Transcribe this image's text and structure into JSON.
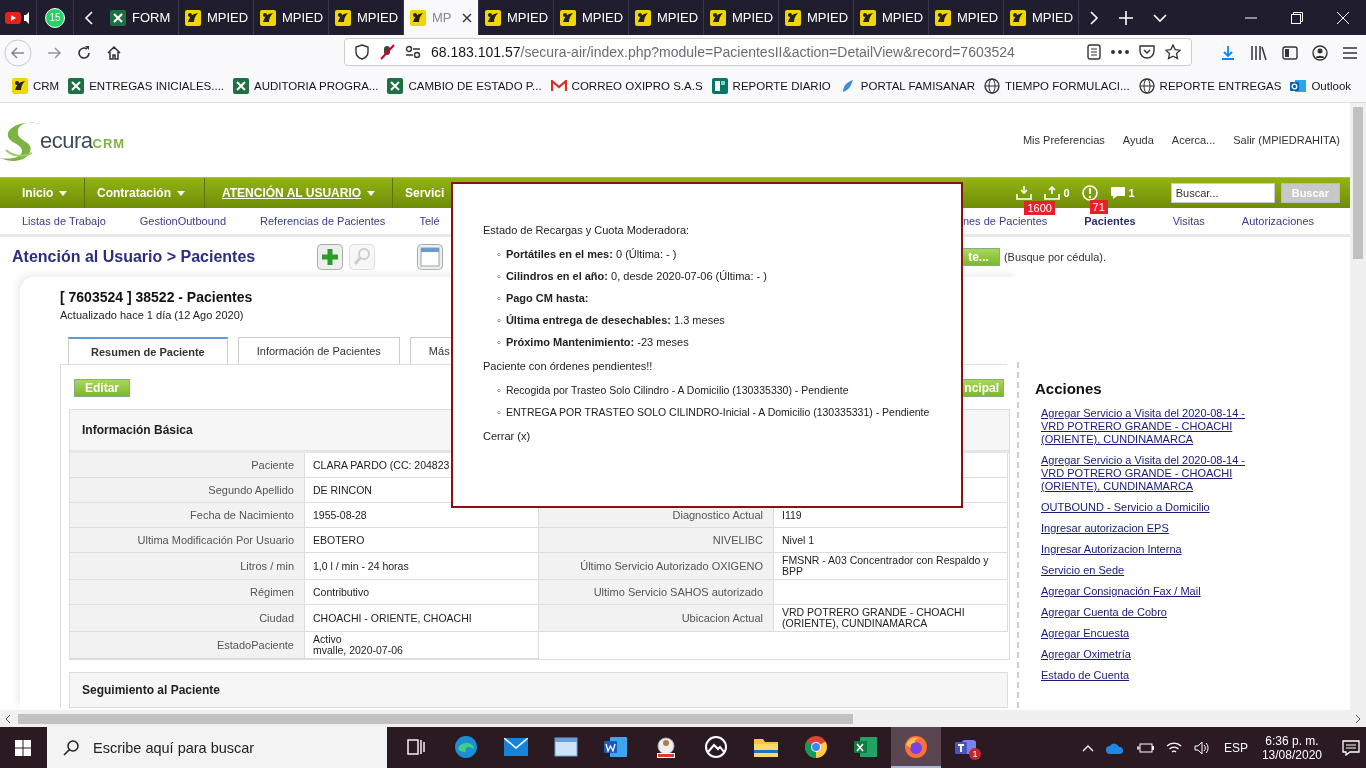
{
  "browser": {
    "pinned_tabs": [
      {
        "kind": "video"
      },
      {
        "kind": "chat",
        "badge": "15"
      }
    ],
    "tabs": [
      {
        "label": "FORM",
        "kind": "sheet",
        "selected": false
      },
      {
        "label": "MPIED",
        "kind": "crm",
        "selected": false
      },
      {
        "label": "MPIED",
        "kind": "crm",
        "selected": false
      },
      {
        "label": "MPIED",
        "kind": "crm",
        "selected": false
      },
      {
        "label": "MP",
        "kind": "crm",
        "selected": true
      },
      {
        "label": "MPIED",
        "kind": "crm",
        "selected": false
      },
      {
        "label": "MPIED",
        "kind": "crm",
        "selected": false
      },
      {
        "label": "MPIED",
        "kind": "crm",
        "selected": false
      },
      {
        "label": "MPIED",
        "kind": "crm",
        "selected": false
      },
      {
        "label": "MPIED",
        "kind": "crm",
        "selected": false
      },
      {
        "label": "MPIED",
        "kind": "crm",
        "selected": false
      },
      {
        "label": "MPIED",
        "kind": "crm",
        "selected": false
      },
      {
        "label": "MPIED",
        "kind": "crm",
        "selected": false
      }
    ],
    "url": {
      "host": "68.183.101.57",
      "path": "/secura-air/index.php?module=PacientesII&action=DetailView&record=7603524"
    },
    "bookmarks": [
      {
        "label": "CRM",
        "kind": "crm"
      },
      {
        "label": "ENTREGAS INICIALES....",
        "kind": "sheet"
      },
      {
        "label": "AUDITORIA PROGRA...",
        "kind": "sheet"
      },
      {
        "label": "CAMBIO DE ESTADO P...",
        "kind": "sheet"
      },
      {
        "label": "CORREO OXIPRO S.A.S",
        "kind": "mail"
      },
      {
        "label": "REPORTE DIARIO",
        "kind": "form"
      },
      {
        "label": "PORTAL FAMISANAR",
        "kind": "leaf"
      },
      {
        "label": "TIEMPO FORMULACI...",
        "kind": "globe"
      },
      {
        "label": "REPORTE ENTREGAS",
        "kind": "globe"
      },
      {
        "label": "Outlook",
        "kind": "outlook"
      }
    ]
  },
  "header": {
    "logo": {
      "word": "ecura",
      "suffix": "CRM"
    },
    "links": [
      "Mis Preferencias",
      "Ayuda",
      "Acerca...",
      "Salir (MPIEDRAHITA)"
    ]
  },
  "main_nav": {
    "items": [
      {
        "label": "Inicio",
        "selected": false,
        "has_menu": true
      },
      {
        "label": "Contratación",
        "selected": false,
        "has_menu": true
      },
      {
        "label": "ATENCIÓN AL USUARIO",
        "selected": true,
        "has_menu": true
      },
      {
        "label": "Servici",
        "selected": false,
        "has_menu": false
      }
    ],
    "notifications": [
      {
        "kind": "inbox",
        "badge": "1600"
      },
      {
        "kind": "outbox",
        "count": "0"
      },
      {
        "kind": "alert",
        "badge": "71"
      },
      {
        "kind": "chat",
        "count": "1"
      }
    ],
    "search": {
      "placeholder": "Buscar...",
      "button": "Buscar"
    }
  },
  "sub_nav": {
    "left": [
      {
        "label": "Listas de Trabajo",
        "selected": false
      },
      {
        "label": "GestionOutbound",
        "selected": false
      },
      {
        "label": "Referencias de Pacientes",
        "selected": false
      },
      {
        "label": "Telé",
        "selected": false
      }
    ],
    "right": [
      {
        "label": "nes de Pacientes",
        "selected": false
      },
      {
        "label": "Pacientes",
        "selected": true
      },
      {
        "label": "Visitas",
        "selected": false
      },
      {
        "label": "Autorizaciones",
        "selected": false
      }
    ]
  },
  "page": {
    "breadcrumb": "Atención al Usuario > Pacientes",
    "search_button": "te...",
    "search_hint": "(Busque por cédula).",
    "record_title": "[ 7603524 ] 38522 - Pacientes",
    "updated": "Actualizado hace 1 día (12 Ago 2020)",
    "tabs": [
      {
        "label": "Resumen de Paciente",
        "selected": true
      },
      {
        "label": "Información de Pacientes",
        "selected": false
      },
      {
        "label": "Más",
        "selected": false
      }
    ],
    "edit_button": "Editar",
    "right_button": "ncipal",
    "section": "Información Básica",
    "rows": [
      {
        "label": "Paciente",
        "value": "CLARA PARDO (CC: 204823"
      },
      {
        "label": "Segundo Apellido",
        "value": "DE RINCON"
      },
      {
        "label": "Fecha de Nacimiento",
        "value": "1955-08-28"
      },
      {
        "label": "Ultima Modificación Por Usuario",
        "value": "EBOTERO"
      },
      {
        "label": "Litros / min",
        "value": "1,0 l / min - 24 horas"
      },
      {
        "label": "Régimen",
        "value": "Contributivo"
      },
      {
        "label": "Ciudad",
        "value": "CHOACHI - ORIENTE, CHOACHI"
      },
      {
        "label": "EstadoPaciente",
        "value": "Activo",
        "note": "mvalle, 2020-07-06"
      }
    ],
    "right_rows": [
      {
        "label": "Diagnostico Actual",
        "value": "I119"
      },
      {
        "label": "NIVELIBC",
        "value": "Nivel 1"
      },
      {
        "label": "Último Servicio Autorizado OXIGENO",
        "value": "FMSNR - A03 Concentrador con Respaldo y BPP"
      },
      {
        "label": "Ultimo Servicio SAHOS autorizado"
      },
      {
        "label": "Ubicacion Actual",
        "value": "VRD POTRERO GRANDE - CHOACHI (ORIENTE), CUNDINAMARCA"
      }
    ],
    "next_section": "Seguimiento al Paciente"
  },
  "actions": {
    "title": "Acciones",
    "links": [
      "Agregar Servicio a Visita del 2020-08-14 - VRD POTRERO GRANDE - CHOACHI (ORIENTE), CUNDINAMARCA",
      "Agregar Servicio a Visita del 2020-08-14 - VRD POTRERO GRANDE - CHOACHI (ORIENTE), CUNDINAMARCA",
      "OUTBOUND - Servicio a Domicilio",
      "Ingresar autorizacion EPS",
      "Ingresar Autorizacion Interna",
      "Servicio en Sede",
      "Agregar Consignación Fax / Mail",
      "Agregar Cuenta de Cobro",
      "Agregar Encuesta",
      "Agregar Oximetría",
      "Estado de Cuenta"
    ]
  },
  "popup": {
    "heading": "Estado de Recargas y Cuota Moderadora:",
    "bullet": "◦",
    "status": [
      "**Portátiles en el mes:** 0 (Última: - )",
      "**Cilindros en el año:** 0, desde 2020-07-06 (Última: - )",
      "**Pago CM hasta:**",
      "**Última entrega de desechables:** 1.3 meses",
      "**Próximo Mantenimiento:** -23 meses"
    ],
    "orders_heading": "Paciente con órdenes pendientes!!",
    "orders": [
      "Recogida por Trasteo Solo Cilindro - A Domicilio (130335330) - Pendiente",
      "ENTREGA POR TRASTEO SOLO CILINDRO-Inicial - A Domicilio (130335331) - Pendiente"
    ],
    "close": "Cerrar (x)"
  },
  "taskbar": {
    "search_placeholder": "Escribe aquí para buscar",
    "apps": [
      {
        "kind": "taskview",
        "selected": false
      },
      {
        "kind": "edge",
        "selected": false
      },
      {
        "kind": "mail",
        "selected": false
      },
      {
        "kind": "window",
        "selected": false
      },
      {
        "kind": "word",
        "selected": false
      },
      {
        "kind": "printer",
        "selected": false
      },
      {
        "kind": "photos",
        "selected": false
      },
      {
        "kind": "folder",
        "selected": false
      },
      {
        "kind": "chrome",
        "selected": false
      },
      {
        "kind": "excel",
        "selected": false
      },
      {
        "kind": "firefox",
        "selected": true
      },
      {
        "kind": "teams",
        "selected": false,
        "badge": "1"
      }
    ],
    "language": "ESP",
    "time": "6:36 p. m.",
    "date": "13/08/2020"
  }
}
